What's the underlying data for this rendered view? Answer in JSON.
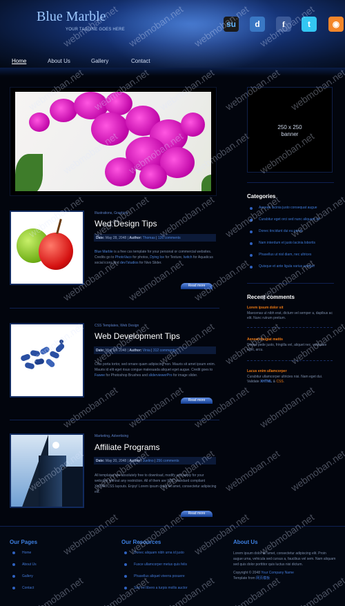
{
  "header": {
    "logo": "Blue Marble",
    "tagline": "YOUR TAGLINE GOES HERE",
    "social": [
      {
        "icon": "stumbleupon-icon",
        "glyph": "su"
      },
      {
        "icon": "delicious-icon",
        "glyph": "d"
      },
      {
        "icon": "facebook-icon",
        "glyph": "f"
      },
      {
        "icon": "twitter-icon",
        "glyph": "t"
      },
      {
        "icon": "rss-icon",
        "glyph": "◉"
      }
    ]
  },
  "nav": [
    "Home",
    "About Us",
    "Gallery",
    "Contact"
  ],
  "posts": [
    {
      "category": "Illustrations, Graphics",
      "title": "Wed Design Tips",
      "meta_date_label": "Date:",
      "meta_date": "May 28, 2048",
      "meta_author_label": "Author:",
      "meta_author": "Thomas",
      "meta_comments": "126 comments",
      "excerpt_parts": [
        "Blue Marble",
        " is a free css template for your personal or commercial websites. Credits go to ",
        "PhotoVaco",
        " for photos, ",
        "Dying Ice",
        " for Texture, ",
        "Iwitch",
        " for Aquaticus social icons and ",
        "dev7studios",
        " for Nivo Slider."
      ],
      "read_more": "Read more"
    },
    {
      "category": "CSS Templates, Web Design",
      "title": "Web Development Tips",
      "meta_date_label": "Date:",
      "meta_date": "May 24, 2048",
      "meta_author_label": "Author:",
      "meta_author": "Vinia",
      "meta_comments": "312 comments",
      "excerpt_parts": [
        "",
        "Cras porta tortor, sed ornare quam adipiscing non. Mauris sit amet ipsum enim. Mauris id elit eget risus congue malesuada aliquet eget augue. Credit goes to ",
        "Fawee",
        " for Photoshop Brushes and ",
        "sliderviewerPro",
        " for image slider."
      ],
      "read_more": "Read more"
    },
    {
      "category": "Marketing, Advertising",
      "title": "Affiliate Programs",
      "meta_date_label": "Date:",
      "meta_date": "May 20, 2048",
      "meta_author_label": "Author:",
      "meta_author": "Juelino",
      "meta_comments": "256 comments",
      "excerpt_parts": [
        "",
        "All templates are absolutely free to download, modify and apply for your websites without any restriction. All of them are W3C standard compliant XHTML/CSS layouts. Enjoy! Lorem ipsum dolor sit amet, consectetur adipiscing elit."
      ],
      "read_more": "Read more"
    }
  ],
  "sidebar": {
    "banner_l1": "250 x 250",
    "banner_l2": "banner",
    "categories_title": "Categories",
    "categories": [
      "Aenean lacinia justo consequat augue",
      "Curabitur eget orci sed nunc aliquam sit",
      "Donec tincidunt dui eu purus",
      "Nam interdum et justo lacinia lobortis",
      "Phasellus ut nisl diam, nec ultrices",
      "Quisque et ante ligula varius semper"
    ],
    "comments_title": "Recent comments",
    "comments": [
      {
        "name": "Lorem ipsum dolor sit",
        "text": "Maecenas ut nibh erat, dictum vel semper a, dapibus ac elit. Nunc rutrum pretium."
      },
      {
        "name": "Aenean feugiat mattis",
        "text": "Donec pede justo, fringilla vel, aliquet nec, vulputate eget, arcu."
      },
      {
        "name": "Lacus enim ullamcorper",
        "text": "Curabitur ullamcorper ultricies nisi. Nam eget dui. Validate ",
        "xhtml": "XHTML",
        "amp": " & ",
        "css": "CSS",
        "end": "."
      }
    ]
  },
  "footer": {
    "pages_title": "Our Pages",
    "pages": [
      "Home",
      "About Us",
      "Gallery",
      "Contact"
    ],
    "resources_title": "Our Resources",
    "resources": [
      "Donec aliquam nibh urna id justo",
      "Fusce ullamcorper metus quis felis",
      "Phasellus aliquet viverra posuere",
      "Sed vel libero a turpis mollis auctor"
    ],
    "about_title": "About Us",
    "about_text": "Lorem ipsum dolor sit amet, consectetur adipiscing elit. Proin augue urna, vehicula sed cursus a, faucibus vel sem. Nam aliquam sed quis dolor porttitor quis luctus nisi dictum.",
    "copyright_pre": "Copyright © 2048 ",
    "company": "Your Company Name",
    "template_pre": "Template from ",
    "template_from": "网页模板"
  },
  "watermark": "webmoban.net"
}
